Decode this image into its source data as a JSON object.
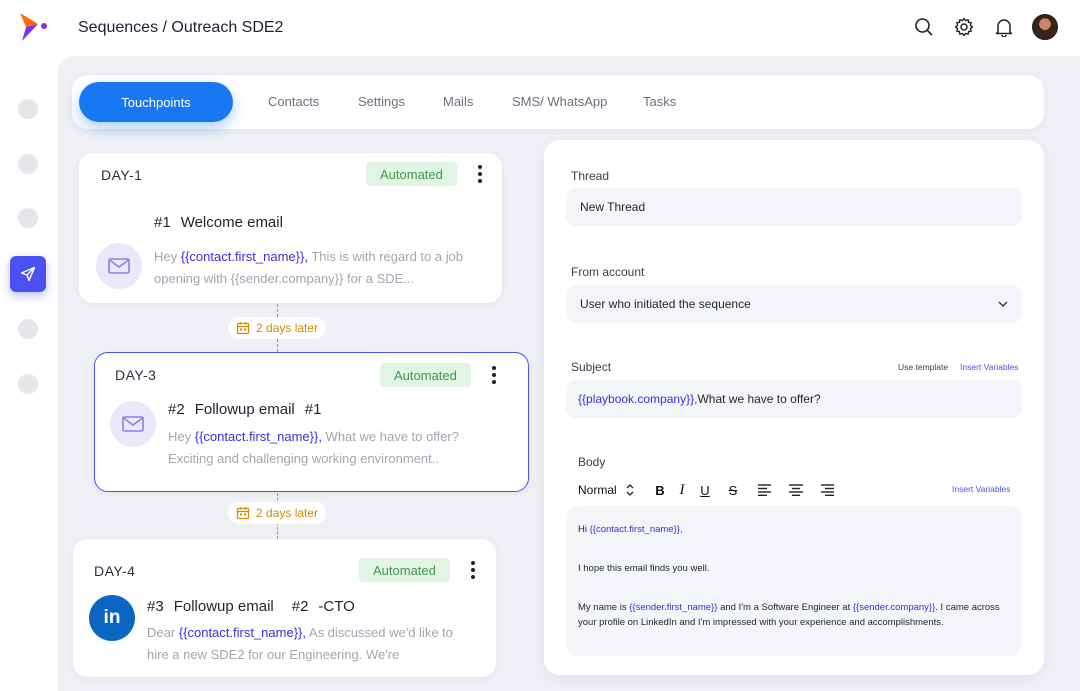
{
  "header": {
    "breadcrumb": "Sequences / Outreach SDE2"
  },
  "tabs": [
    {
      "label": "Touchpoints",
      "active": true
    },
    {
      "label": "Contacts"
    },
    {
      "label": "Settings"
    },
    {
      "label": "Mails"
    },
    {
      "label": "SMS/ WhatsApp"
    },
    {
      "label": "Tasks"
    }
  ],
  "steps": [
    {
      "day": "DAY-1",
      "badge": "Automated",
      "number": "#1",
      "title": "Welcome email",
      "preview_prefix": "Hey ",
      "preview_var": "{{contact.first_name}},",
      "preview_rest": " This is with regard to a job opening with {{sender.company}} for a SDE...",
      "icon": "mail-icon"
    },
    {
      "day": "DAY-3",
      "badge": "Automated",
      "number": "#2",
      "title": "Followup email",
      "suffix": "#1",
      "preview_prefix": "Hey ",
      "preview_var": "{{contact.first_name}},",
      "preview_rest": " What we have to offer?",
      "preview_line2": "Exciting and challenging working environment..",
      "icon": "mail-icon",
      "selected": true
    },
    {
      "day": "DAY-4",
      "badge": "Automated",
      "number": "#3",
      "title": "Followup email",
      "suffix": "#2",
      "suffix2": "-CTO",
      "preview_prefix": "Dear ",
      "preview_var": "{{contact.first_name}},",
      "preview_rest": " As discussed we'd like to hire a new SDE2 for our Engineering. We're",
      "icon": "linkedin-icon",
      "icon_text": "in"
    }
  ],
  "delays": [
    "2 days later",
    "2 days later"
  ],
  "editor": {
    "thread_label": "Thread",
    "thread_value": "New Thread",
    "from_label": "From account",
    "from_value": "User who initiated the sequence",
    "subject_label": "Subject",
    "use_template": "Use template",
    "insert_variables": "Insert Variables",
    "subject_var": "{{playbook.company}},",
    "subject_rest": " What we have to offer?",
    "body_label": "Body",
    "format_value": "Normal",
    "body_insert_variables": "Insert Variables",
    "body": {
      "greeting_prefix": "Hi ",
      "greeting_var": "{{contact.first_name}},",
      "line2": "I hope this email finds you well.",
      "p3_a": "My name is ",
      "p3_var1": "{{sender.first_name}}",
      "p3_b": " and I'm a Software Engineer at ",
      "p3_var2": "{{sender.company}}",
      "p3_c": ". I came across your profile on LinkedIn and I'm impressed with your experience and accomplishments."
    }
  },
  "colors": {
    "accent": "#1877f2",
    "rail_active": "#4b50f0",
    "variable": "#3a2ee0",
    "badge_bg": "#e2f5e4",
    "badge_text": "#3d9a4a",
    "delay_text": "#d98a00",
    "selected_border": "#4b50f0"
  }
}
